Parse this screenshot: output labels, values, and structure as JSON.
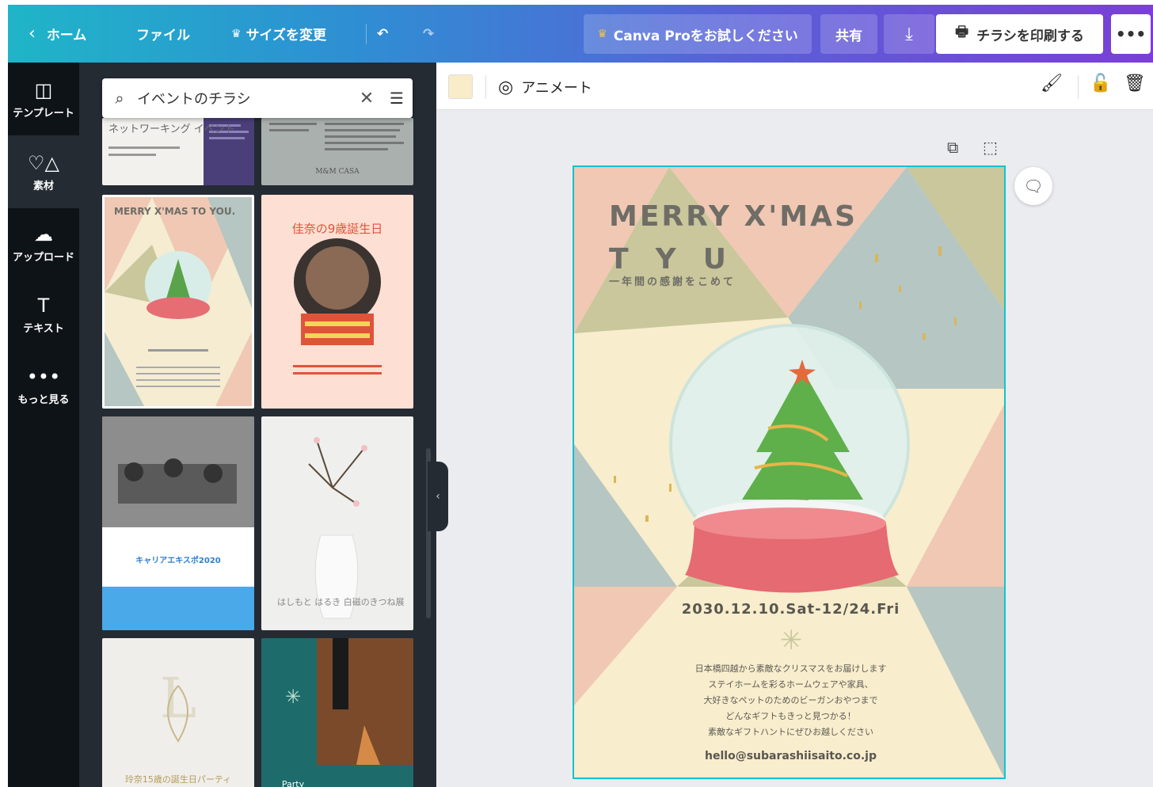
{
  "topbar": {
    "home_label": "ホーム",
    "file_label": "ファイル",
    "resize_label": "サイズを変更",
    "pro_label": "Canva Proをお試しください",
    "share_label": "共有",
    "print_label": "チラシを印刷する",
    "more_label": "•••"
  },
  "rail": {
    "items": [
      {
        "label": "テンプレート",
        "icon": "template-icon"
      },
      {
        "label": "素材",
        "icon": "elements-icon"
      },
      {
        "label": "アップロード",
        "icon": "upload-icon"
      },
      {
        "label": "テキスト",
        "icon": "text-icon"
      },
      {
        "label": "もっと見る",
        "icon": "more-icon"
      }
    ]
  },
  "panel": {
    "search_value": "イベントのチラシ",
    "templates": [
      {
        "title": "ネットワーキング イベント"
      },
      {
        "title": "M&M CASA"
      },
      {
        "title": "MERRY X'MAS TO YOU."
      },
      {
        "title": "佳奈の9歳誕生日"
      },
      {
        "title": "キャリアエキスポ2020"
      },
      {
        "title": "はしもと はるき 白磁のきつね展"
      },
      {
        "title": "玲奈15歳の誕生日パーティ"
      },
      {
        "title": "Party"
      }
    ]
  },
  "toolbar": {
    "swatch_color": "#f9ecc8",
    "animate_label": "アニメート"
  },
  "poster": {
    "title_line1": "MERRY X'MAS",
    "title_line2": "T  Y  U",
    "subtitle": "一年間の感謝をこめて",
    "date": "2030.12.10.Sat-12/24.Fri",
    "body": [
      "日本橋四越から素敵なクリスマスをお届けします",
      "ステイホームを彩るホームウェアや家具、",
      "大好きなペットのためのビーガンおやつまで",
      "どんなギフトもきっと見つかる！",
      "素敵なギフトハントにぜひお越しください"
    ],
    "email": "hello@subarashiisaito.co.jp",
    "colors": {
      "cream": "#f8edcc",
      "pink": "#f0c8b4",
      "olive": "#c9c79b",
      "blue": "#b6c6c2",
      "frame": "#14c2cf"
    }
  }
}
